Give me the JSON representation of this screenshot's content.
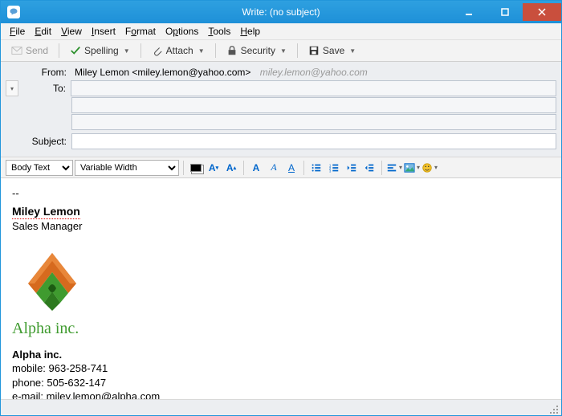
{
  "window": {
    "title": "Write: (no subject)"
  },
  "menu": {
    "file": "File",
    "edit": "Edit",
    "view": "View",
    "insert": "Insert",
    "format": "Format",
    "options": "Options",
    "tools": "Tools",
    "help": "Help"
  },
  "toolbar": {
    "send": "Send",
    "spelling": "Spelling",
    "attach": "Attach",
    "security": "Security",
    "save": "Save"
  },
  "headers": {
    "from_label": "From:",
    "from_value": "Miley Lemon <miley.lemon@yahoo.com>",
    "from_extra": "miley.lemon@yahoo.com",
    "to_label": "To:",
    "to_value": "",
    "subject_label": "Subject:",
    "subject_value": ""
  },
  "format": {
    "para": "Body Text",
    "font": "Variable Width"
  },
  "signature": {
    "dashes": "--",
    "name": "Miley Lemon",
    "title": "Sales Manager",
    "company_logo_text": "Alpha inc.",
    "company": "Alpha inc.",
    "mobile_label": "mobile: ",
    "mobile": "963-258-741",
    "phone_label": "phone: ",
    "phone": "505-632-147",
    "email_label": "e-mail: ",
    "email": "miley.lemon@alpha.com"
  }
}
